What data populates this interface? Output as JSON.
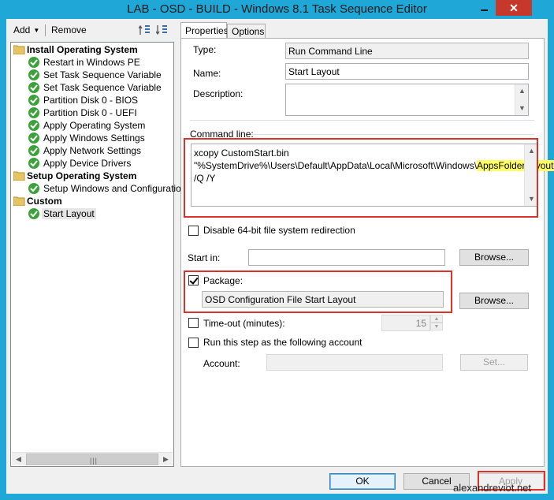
{
  "window": {
    "title": "LAB - OSD - BUILD - Windows 8.1 Task Sequence Editor",
    "close_glyph": "✕"
  },
  "toolbar": {
    "add_label": "Add",
    "remove_label": "Remove"
  },
  "tree": {
    "groups": [
      {
        "label": "Install Operating System",
        "steps": [
          "Restart in Windows PE",
          "Set Task Sequence Variable",
          "Set Task Sequence Variable",
          "Partition Disk 0 - BIOS",
          "Partition Disk 0 - UEFI",
          "Apply Operating System",
          "Apply Windows Settings",
          "Apply Network Settings",
          "Apply Device Drivers"
        ]
      },
      {
        "label": "Setup Operating System",
        "steps": [
          "Setup Windows and Configuration"
        ]
      },
      {
        "label": "Custom",
        "steps": [
          "Start Layout"
        ]
      }
    ],
    "selected": "Start Layout"
  },
  "tabs": {
    "properties": "Properties",
    "options": "Options"
  },
  "properties": {
    "type_label": "Type:",
    "type_value": "Run Command Line",
    "name_label": "Name:",
    "name_value": "Start Layout",
    "description_label": "Description:",
    "description_value": "",
    "command_line_label": "Command line:",
    "command_line_before": "xcopy CustomStart.bin \"%SystemDrive%\\Users\\Default\\AppData\\Local\\Microsoft\\Windows\\",
    "command_line_highlight": "AppsFolderLayout.bin\"",
    "command_line_after": " /Q /Y",
    "disable_64bit_label": "Disable 64-bit file system redirection",
    "disable_64bit_checked": false,
    "start_in_label": "Start in:",
    "start_in_value": "",
    "browse_label": "Browse...",
    "package_label": "Package:",
    "package_checked": true,
    "package_value": "OSD Configuration File Start Layout",
    "timeout_label": "Time-out (minutes):",
    "timeout_checked": false,
    "timeout_value": "15",
    "run_as_label": "Run this step as the following account",
    "run_as_checked": false,
    "account_label": "Account:",
    "account_value": "",
    "set_label": "Set..."
  },
  "buttons": {
    "ok": "OK",
    "cancel": "Cancel",
    "apply": "Apply"
  },
  "watermark": "alexandreviot.net",
  "colors": {
    "title_bar": "#1ea7d7",
    "highlight_annotation": "#d9342b",
    "text_highlight": "#ffff66"
  }
}
